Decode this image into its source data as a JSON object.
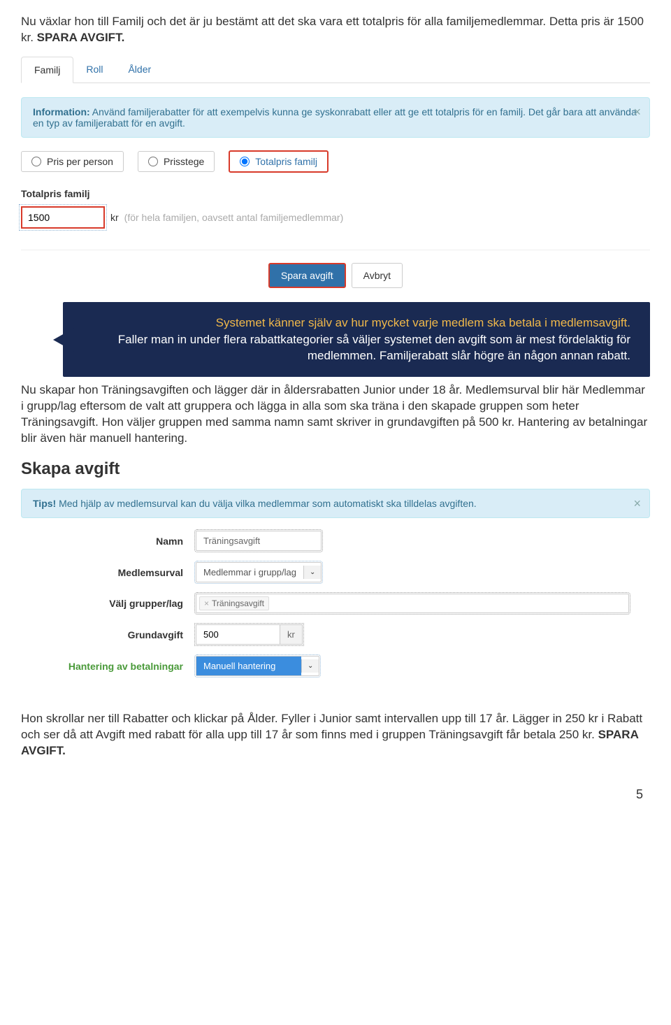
{
  "intro": {
    "text1": "Nu växlar hon till Familj och det är ju bestämt att det ska vara ett totalpris för alla familjemedlemmar. Detta pris är 1500 kr. ",
    "bold1": "SPARA AVGIFT."
  },
  "tabs": {
    "familj": "Familj",
    "roll": "Roll",
    "alder": "Ålder"
  },
  "info1": {
    "strong": "Information:",
    "text": " Använd familjerabatter för att exempelvis kunna ge syskonrabatt eller att ge ett totalpris för en familj. Det går bara att använda en typ av familjerabatt för en avgift."
  },
  "radios": {
    "opt1": "Pris per person",
    "opt2": "Prisstege",
    "opt3": "Totalpris familj"
  },
  "totalpris": {
    "label": "Totalpris familj",
    "value": "1500",
    "unit": "kr",
    "hint": "(för hela familjen, oavsett antal familjemedlemmar)"
  },
  "buttons": {
    "save": "Spara avgift",
    "cancel": "Avbryt"
  },
  "callout": {
    "line1": "Systemet känner själv av hur mycket varje medlem ska betala i medlemsavgift.",
    "rest": "Faller man in under flera rabattkategorier så väljer systemet den avgift som är mest fördelaktig för medlemmen. Familjerabatt slår högre än någon annan rabatt."
  },
  "para2": "Nu skapar hon Träningsavgiften och lägger där in åldersrabatten Junior under 18  år. Medlemsurval blir här Medlemmar i grupp/lag eftersom de valt att gruppera och lägga in alla som ska träna i den skapade gruppen som heter Träningsavgift. Hon väljer gruppen med samma namn samt skriver in grundavgiften på 500 kr. Hantering av betalningar blir även här manuell hantering.",
  "section2": {
    "heading": "Skapa avgift",
    "tip_strong": "Tips!",
    "tip_text": " Med hjälp av medlemsurval kan du välja vilka medlemmar som automatiskt ska tilldelas avgiften.",
    "namn_label": "Namn",
    "namn_value": "Träningsavgift",
    "medlemsurval_label": "Medlemsurval",
    "medlemsurval_value": "Medlemmar i grupp/lag",
    "valj_label": "Välj grupper/lag",
    "valj_tag": "Träningsavgift",
    "grundavgift_label": "Grundavgift",
    "grundavgift_value": "500",
    "grundavgift_unit": "kr",
    "hantering_label": "Hantering av betalningar",
    "hantering_value": "Manuell hantering"
  },
  "para3": {
    "text": "Hon skrollar ner till Rabatter och klickar på Ålder. Fyller i Junior samt intervallen upp till 17 år. Lägger in 250 kr i Rabatt och ser då att Avgift med rabatt för alla upp till 17 år som finns med i gruppen Träningsavgift får betala 250 kr. ",
    "bold": "SPARA AVGIFT."
  },
  "pagenum": "5"
}
